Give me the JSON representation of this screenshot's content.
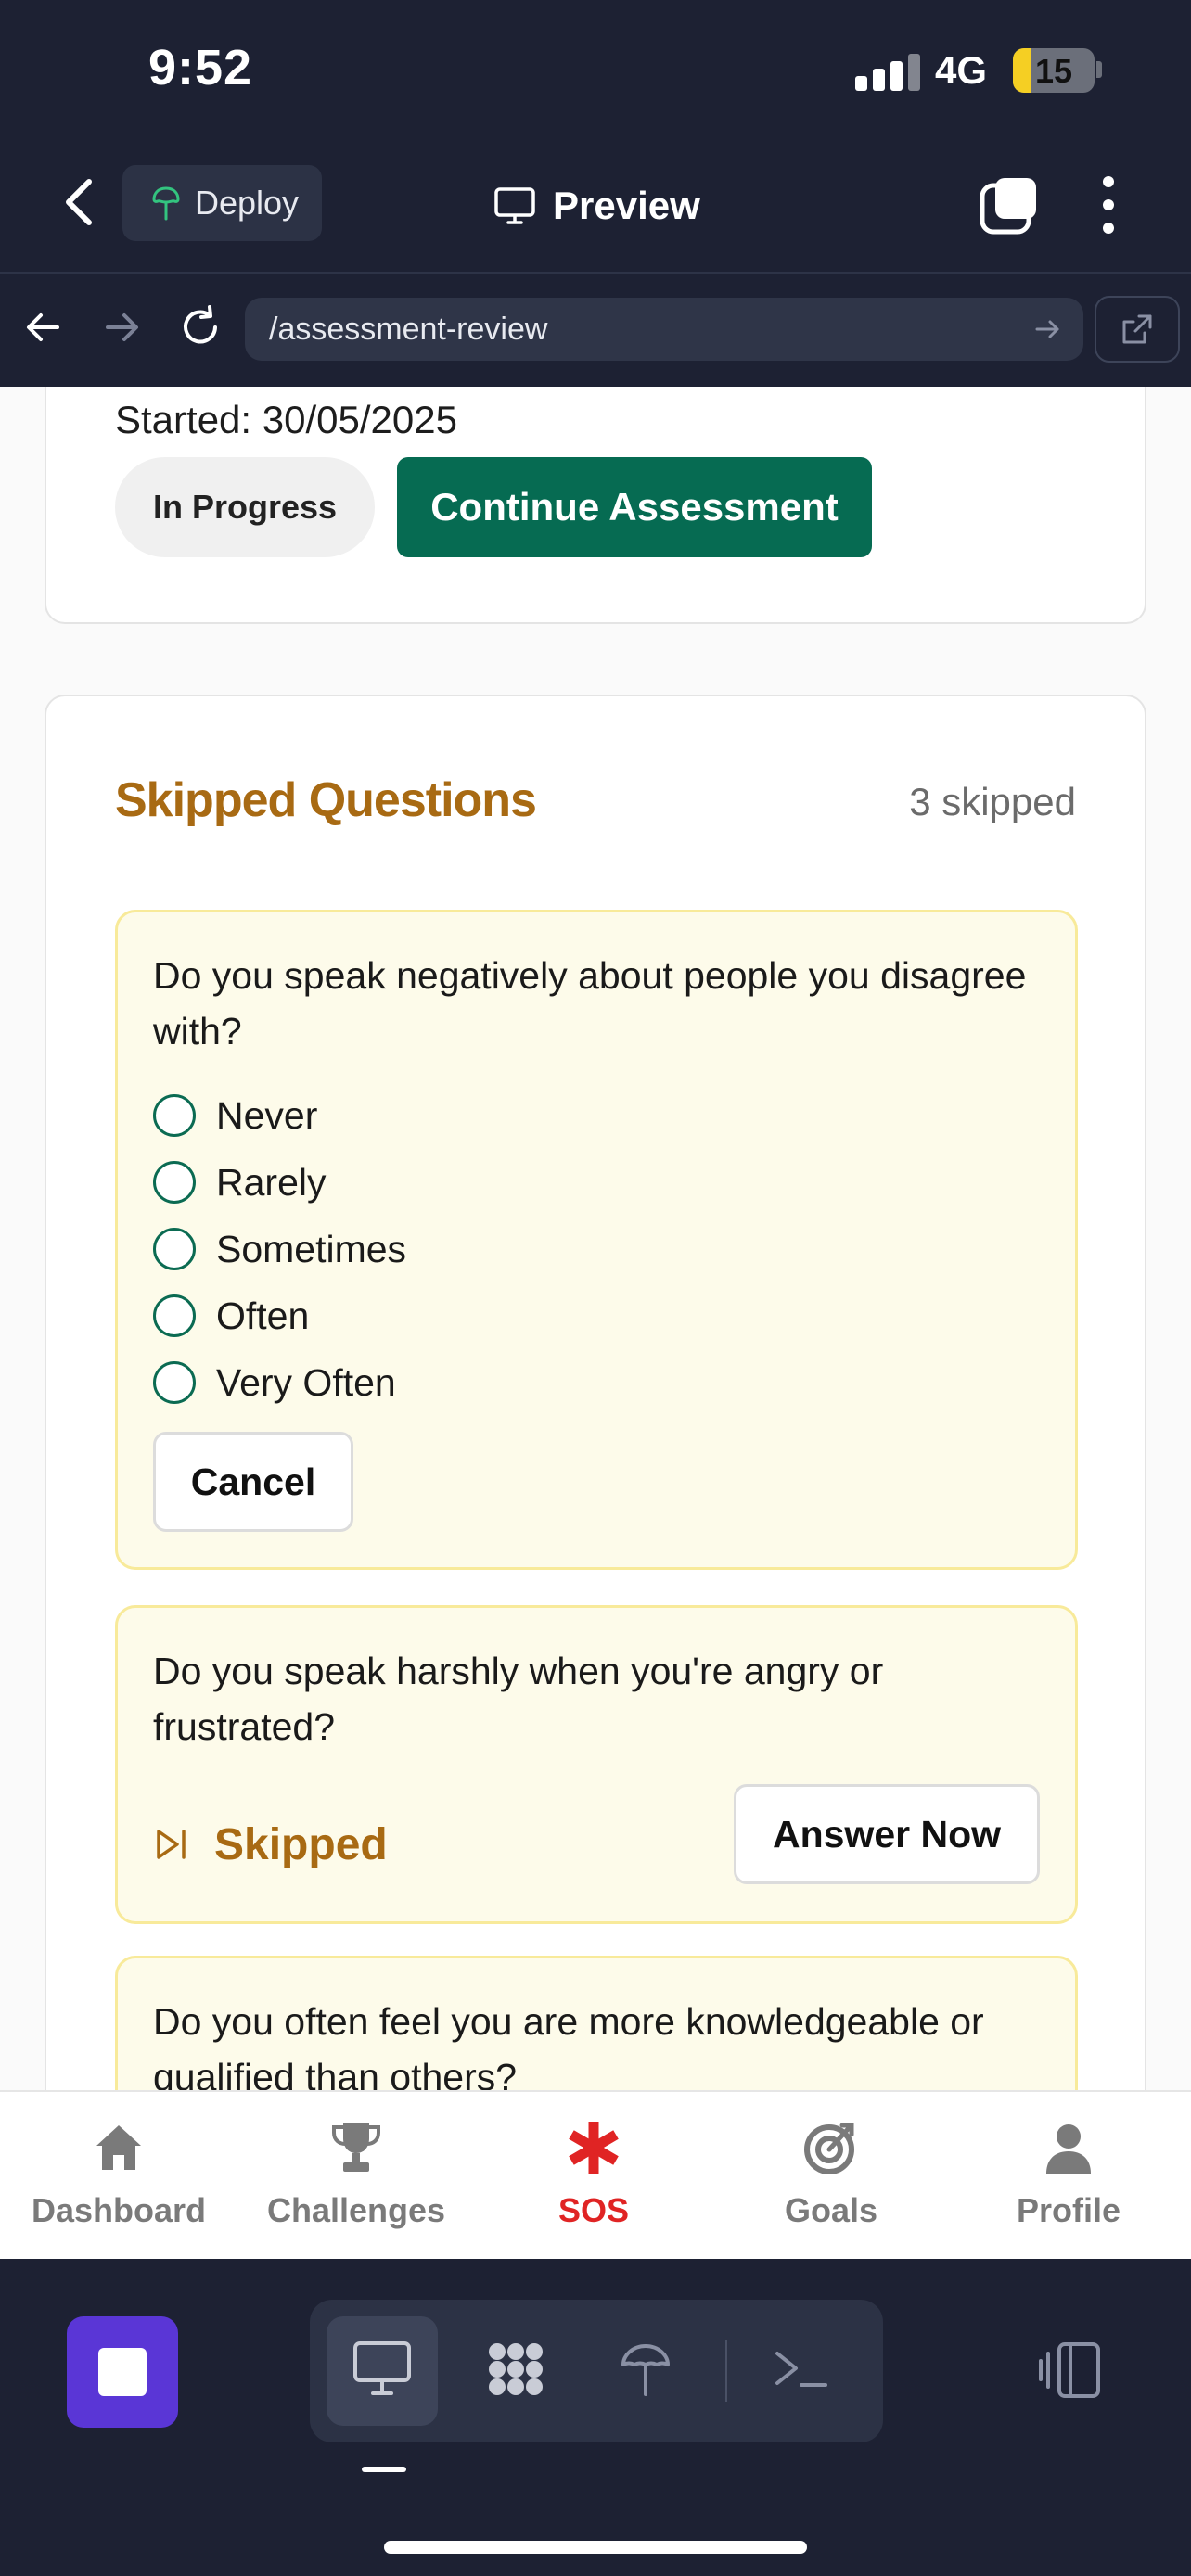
{
  "status_bar": {
    "time": "9:52",
    "network": "4G",
    "battery": "15"
  },
  "toolbar": {
    "deploy_label": "Deploy",
    "preview_label": "Preview"
  },
  "browser": {
    "url": "/assessment-review"
  },
  "assessment": {
    "started": "Started: 30/05/2025",
    "status_badge": "In Progress",
    "continue_label": "Continue Assessment"
  },
  "skipped": {
    "title": "Skipped Questions",
    "count": "3 skipped",
    "questions": [
      {
        "text": "Do you speak negatively about people you disagree with?",
        "options": [
          "Never",
          "Rarely",
          "Sometimes",
          "Often",
          "Very Often"
        ],
        "cancel_label": "Cancel"
      },
      {
        "text": "Do you speak harshly when you're angry or frustrated?",
        "status": "Skipped",
        "answer_label": "Answer Now"
      },
      {
        "text": "Do you often feel you are more knowledgeable or qualified than others?"
      }
    ]
  },
  "tabbar": {
    "items": [
      {
        "label": "Dashboard",
        "icon": "home-icon"
      },
      {
        "label": "Challenges",
        "icon": "trophy-icon"
      },
      {
        "label": "SOS",
        "icon": "asterisk-icon",
        "active": true
      },
      {
        "label": "Goals",
        "icon": "target-icon"
      },
      {
        "label": "Profile",
        "icon": "user-icon"
      }
    ]
  },
  "colors": {
    "accent_green": "#066b52",
    "skipped_gold": "#a86a13",
    "sos_red": "#e02424",
    "chrome_dark": "#1d2133"
  }
}
